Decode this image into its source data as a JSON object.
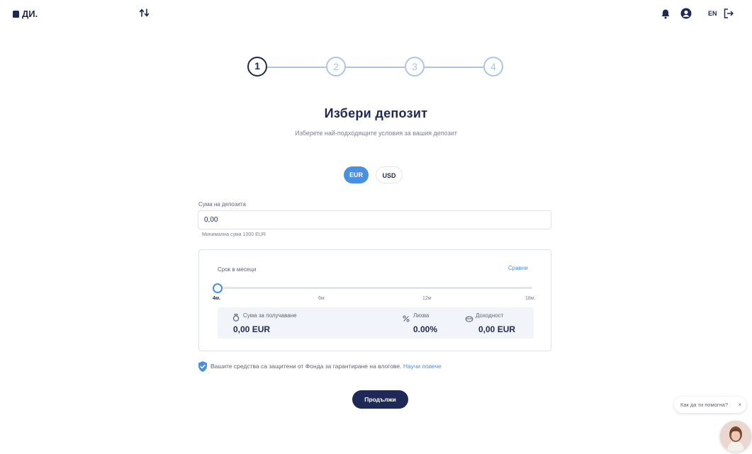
{
  "header": {
    "logo_text": "ДИ.",
    "language": "EN"
  },
  "steps": [
    {
      "num": "1",
      "state": "active"
    },
    {
      "num": "2",
      "state": "inactive"
    },
    {
      "num": "3",
      "state": "inactive"
    },
    {
      "num": "4",
      "state": "inactive"
    }
  ],
  "page": {
    "title": "Избери депозит",
    "subtitle": "Изберете най-подходящите условия за вашия депозит"
  },
  "currency": {
    "options": [
      "EUR",
      "USD"
    ],
    "selected": "EUR"
  },
  "amount": {
    "label": "Сума на депозита",
    "value": "0,00",
    "hint": "Минимална сума 1000 EUR"
  },
  "term": {
    "label": "Срок в месеци",
    "compare_link": "Сравни",
    "ticks": [
      "4м.",
      "6м",
      "12м",
      "18м."
    ],
    "selected_tick": "4м."
  },
  "results": {
    "receive_label": "Сума за получаване",
    "receive_value": "0,00 EUR",
    "interest_label": "Лихва",
    "interest_value": "0.00%",
    "yield_label": "Доходност",
    "yield_value": "0,00 EUR"
  },
  "notice": {
    "text": "Вашите средства са защитени от Фонда за гарантиране на влогове.",
    "link": "Научи повече"
  },
  "continue_label": "Продължи",
  "chat": {
    "bubble_text": "Как да ти помогна?",
    "close_glyph": "×"
  },
  "icons": {
    "logo": "lock-icon",
    "transfer": "transfer-arrows-icon",
    "bell": "bell-icon",
    "user": "user-circle-icon",
    "logout": "logout-icon",
    "receive": "ring-icon",
    "interest": "percent-icon",
    "yield": "piggy-icon",
    "shield": "shield-check-icon"
  },
  "colors": {
    "primary": "#1e2a55",
    "accent": "#4a90e2",
    "step_inactive": "#a9c7ec"
  }
}
